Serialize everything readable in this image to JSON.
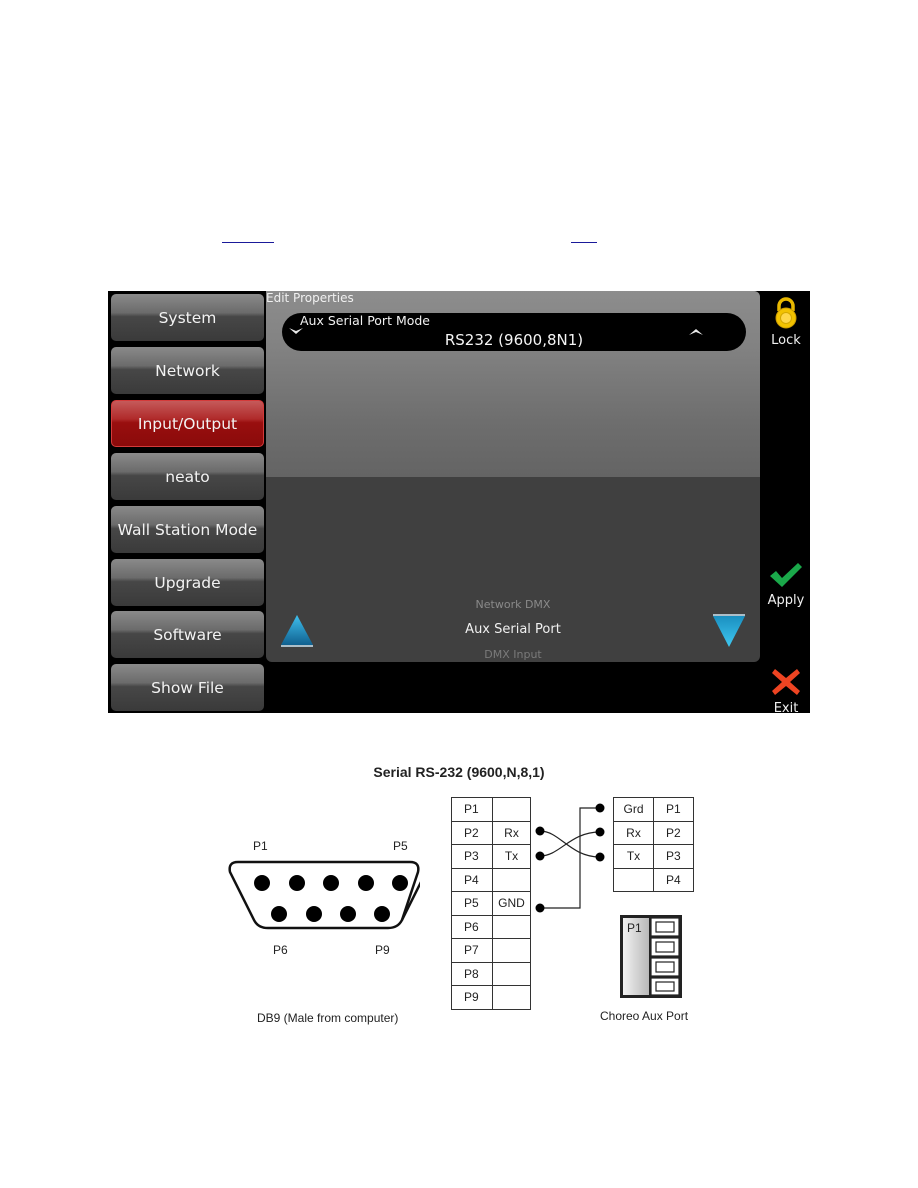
{
  "links": [
    {
      "text": ""
    },
    {
      "text": ""
    }
  ],
  "sidebar": {
    "items": [
      {
        "label": "System",
        "active": false
      },
      {
        "label": "Network",
        "active": false
      },
      {
        "label": "Input/Output",
        "active": true
      },
      {
        "label": "neato",
        "active": false
      },
      {
        "label": "Wall Station Mode",
        "active": false
      },
      {
        "label": "Upgrade",
        "active": false
      },
      {
        "label": "Software",
        "active": false
      },
      {
        "label": "Show File",
        "active": false
      }
    ]
  },
  "panel": {
    "title": "Edit Properties",
    "dropdown": {
      "label": "Aux Serial Port Mode",
      "value": "RS232 (9600,8N1)"
    },
    "list": {
      "previous": "Network DMX",
      "current": "Aux Serial Port",
      "next": "DMX Input"
    }
  },
  "actions": {
    "lock": "Lock",
    "apply": "Apply",
    "exit": "Exit"
  },
  "colors": {
    "active_tab": "#990f0f",
    "lock": "#f2c200",
    "apply": "#1aa84a",
    "exit": "#ee4422",
    "arrow": "#1a8fc0"
  },
  "diagram": {
    "title": "Serial RS-232 (9600,N,8,1)",
    "db9": {
      "caption": "DB9 (Male from computer)",
      "labels": {
        "top_left": "P1",
        "top_right": "P5",
        "bottom_left": "P6",
        "bottom_right": "P9"
      }
    },
    "left_table": [
      {
        "pin": "P1",
        "signal": ""
      },
      {
        "pin": "P2",
        "signal": "Rx"
      },
      {
        "pin": "P3",
        "signal": "Tx"
      },
      {
        "pin": "P4",
        "signal": ""
      },
      {
        "pin": "P5",
        "signal": "GND"
      },
      {
        "pin": "P6",
        "signal": ""
      },
      {
        "pin": "P7",
        "signal": ""
      },
      {
        "pin": "P8",
        "signal": ""
      },
      {
        "pin": "P9",
        "signal": ""
      }
    ],
    "right_table": [
      {
        "signal": "Grd",
        "pin": "P1"
      },
      {
        "signal": "Rx",
        "pin": "P2"
      },
      {
        "signal": "Tx",
        "pin": "P3"
      },
      {
        "signal": "",
        "pin": "P4"
      }
    ],
    "aux_port": {
      "label": "P1",
      "caption": "Choreo Aux Port"
    }
  }
}
